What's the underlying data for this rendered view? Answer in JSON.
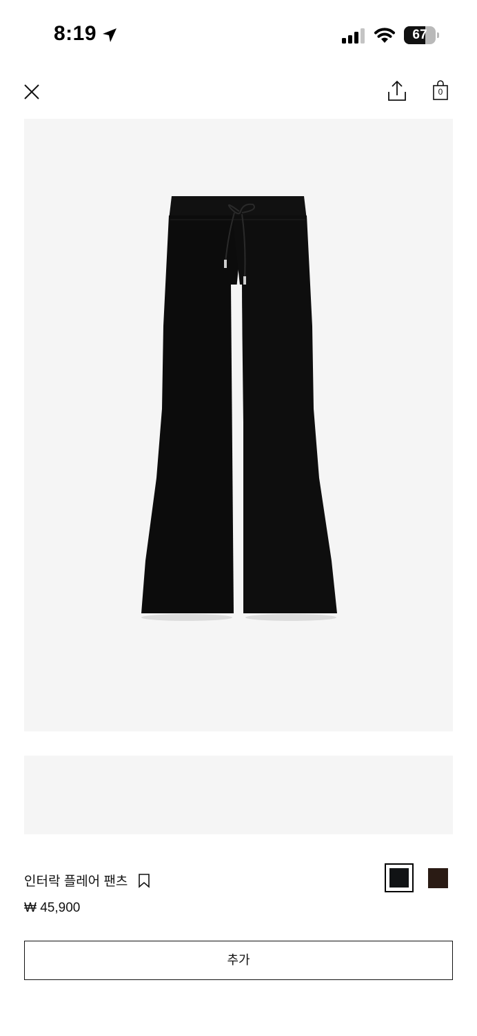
{
  "status_bar": {
    "time": "8:19",
    "battery_level": "67",
    "battery_fraction": 0.67,
    "icons": [
      "location-arrow-icon",
      "signal-bars-icon",
      "wifi-icon",
      "battery-icon"
    ]
  },
  "header": {
    "close_icon": "close-icon",
    "share_icon": "share-icon",
    "cart_icon": "shopping-bag-icon",
    "cart_count": "0"
  },
  "product": {
    "image_description_icon": "product-photo",
    "name": "인터락 플레어 팬츠",
    "bookmark_icon": "bookmark-icon",
    "price": "₩ 45,900",
    "colors": [
      {
        "hex": "#111315",
        "selected": true
      },
      {
        "hex": "#2a1b14",
        "selected": false
      }
    ],
    "add_label": "추가"
  },
  "colors": {
    "background": "#ffffff",
    "image_background": "#f5f5f5",
    "text": "#111111"
  }
}
